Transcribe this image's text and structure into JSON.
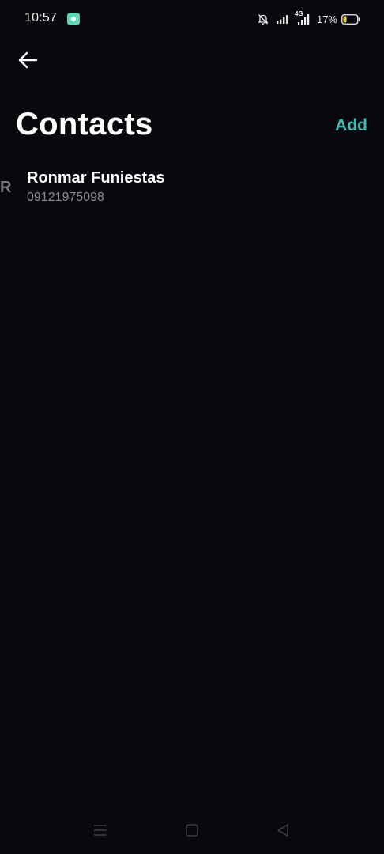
{
  "status_bar": {
    "time": "10:57",
    "battery_percent": "17%",
    "network_label": "4G",
    "icons": [
      "app-notification-icon",
      "silent-bell-icon",
      "signal-icon",
      "signal-4g-icon",
      "battery-icon"
    ]
  },
  "header": {
    "title": "Contacts",
    "add_label": "Add",
    "back_icon": "arrow-left-icon"
  },
  "contacts": {
    "section_letter": "R",
    "items": [
      {
        "name": "Ronmar Funiestas",
        "phone": "09121975098"
      }
    ]
  },
  "navigation": {
    "buttons": [
      "menu-icon",
      "home-icon",
      "back-triangle-icon"
    ]
  },
  "colors": {
    "background": "#09090d",
    "accent": "#3fb7b2",
    "text_primary": "#ffffff",
    "text_secondary": "#8b8b90",
    "battery_fill": "#e8dc4a"
  }
}
